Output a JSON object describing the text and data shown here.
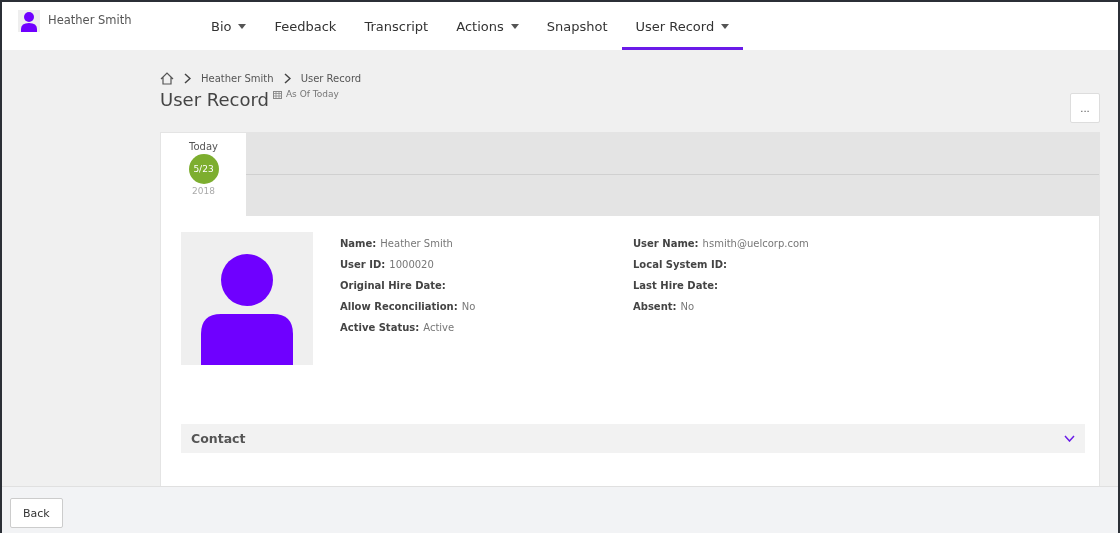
{
  "user": {
    "name": "Heather Smith"
  },
  "tabs": [
    {
      "label": "Bio",
      "dropdown": true,
      "selected": false
    },
    {
      "label": "Feedback",
      "dropdown": false,
      "selected": false
    },
    {
      "label": "Transcript",
      "dropdown": false,
      "selected": false
    },
    {
      "label": "Actions",
      "dropdown": true,
      "selected": false
    },
    {
      "label": "Snapshot",
      "dropdown": false,
      "selected": false
    },
    {
      "label": "User Record",
      "dropdown": true,
      "selected": true
    }
  ],
  "breadcrumb": [
    "Heather Smith",
    "User Record"
  ],
  "page": {
    "title": "User Record",
    "as_of": "As Of Today",
    "more_button": "..."
  },
  "timeline": [
    {
      "label": "Today",
      "date": "5/23",
      "year": "2018",
      "selected": true
    }
  ],
  "fields_left": [
    {
      "label": "Name:",
      "value": "Heather Smith"
    },
    {
      "label": "User ID:",
      "value": "1000020"
    },
    {
      "label": "Original Hire Date:"
    },
    {
      "label": "Allow Reconciliation:",
      "value": "No"
    },
    {
      "label": "Active Status:",
      "value": "Active"
    }
  ],
  "fields_right": [
    {
      "label": "User Name:",
      "value": "hsmith@uelcorp.com"
    },
    {
      "label": "Local System ID:"
    },
    {
      "label": "Last Hire Date:"
    },
    {
      "label": "Absent:",
      "value": "No"
    }
  ],
  "sections": [
    {
      "title": "Contact",
      "expanded": false
    }
  ],
  "footer": {
    "back": "Back"
  }
}
